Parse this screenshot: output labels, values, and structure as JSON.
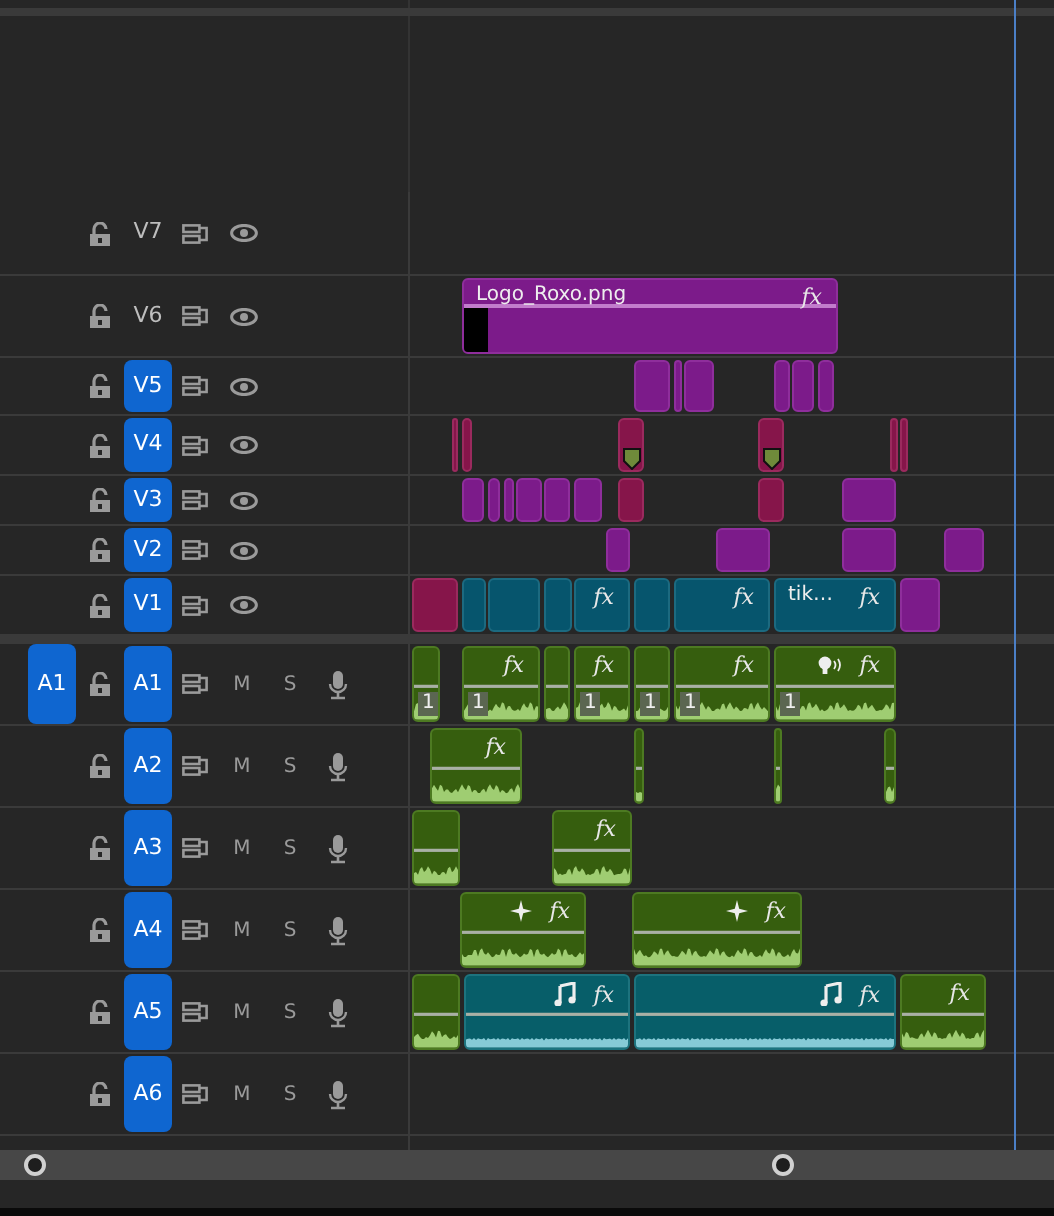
{
  "source_patch": {
    "label": "A1",
    "selected": true
  },
  "video_tracks": [
    {
      "name": "V7",
      "targeted": false
    },
    {
      "name": "V6",
      "targeted": false,
      "clips": [
        {
          "kind": "graphic",
          "label": "Logo_Roxo.png",
          "fx": "fx",
          "thumbnail": true
        }
      ]
    },
    {
      "name": "V5",
      "targeted": true,
      "clips": [
        {
          "kind": "graphic"
        },
        {
          "kind": "graphic"
        },
        {
          "kind": "graphic"
        },
        {
          "kind": "graphic"
        },
        {
          "kind": "graphic"
        },
        {
          "kind": "graphic"
        }
      ]
    },
    {
      "name": "V4",
      "targeted": true,
      "clips": [
        {
          "kind": "nested",
          "marker": false
        },
        {
          "kind": "nested",
          "marker": false
        },
        {
          "kind": "nested",
          "marker": true
        },
        {
          "kind": "nested",
          "marker": true
        },
        {
          "kind": "nested",
          "marker": false
        },
        {
          "kind": "nested",
          "marker": false
        }
      ]
    },
    {
      "name": "V3",
      "targeted": true,
      "clips": [
        {
          "kind": "graphic"
        },
        {
          "kind": "graphic"
        },
        {
          "kind": "graphic"
        },
        {
          "kind": "graphic"
        },
        {
          "kind": "graphic"
        },
        {
          "kind": "graphic"
        },
        {
          "kind": "nested"
        },
        {
          "kind": "nested"
        },
        {
          "kind": "graphic"
        }
      ]
    },
    {
      "name": "V2",
      "targeted": true,
      "clips": [
        {
          "kind": "graphic"
        },
        {
          "kind": "graphic"
        },
        {
          "kind": "graphic"
        },
        {
          "kind": "graphic"
        }
      ]
    },
    {
      "name": "V1",
      "targeted": true,
      "clips": [
        {
          "kind": "nested"
        },
        {
          "kind": "video"
        },
        {
          "kind": "video"
        },
        {
          "kind": "video"
        },
        {
          "kind": "video",
          "fx": "fx"
        },
        {
          "kind": "video"
        },
        {
          "kind": "video",
          "fx": "fx"
        },
        {
          "kind": "video",
          "label": "tik…",
          "fx": "fx"
        },
        {
          "kind": "graphic"
        }
      ]
    }
  ],
  "audio_tracks": [
    {
      "name": "A1",
      "targeted": true,
      "mute": "M",
      "solo": "S",
      "clips": [
        {
          "kind": "audio",
          "channel": "1"
        },
        {
          "kind": "audio",
          "channel": "1",
          "fx": "fx"
        },
        {
          "kind": "audio"
        },
        {
          "kind": "audio",
          "channel": "1",
          "fx": "fx"
        },
        {
          "kind": "audio",
          "channel": "1"
        },
        {
          "kind": "audio",
          "channel": "1",
          "fx": "fx"
        },
        {
          "kind": "speech",
          "channel": "1",
          "fx": "fx"
        }
      ]
    },
    {
      "name": "A2",
      "targeted": true,
      "mute": "M",
      "solo": "S",
      "clips": [
        {
          "kind": "audio",
          "fx": "fx"
        },
        {
          "kind": "audio"
        },
        {
          "kind": "audio"
        },
        {
          "kind": "audio"
        }
      ]
    },
    {
      "name": "A3",
      "targeted": true,
      "mute": "M",
      "solo": "S",
      "clips": [
        {
          "kind": "audio"
        },
        {
          "kind": "audio",
          "fx": "fx"
        }
      ]
    },
    {
      "name": "A4",
      "targeted": true,
      "mute": "M",
      "solo": "S",
      "clips": [
        {
          "kind": "enhanced",
          "fx": "fx"
        },
        {
          "kind": "enhanced",
          "fx": "fx"
        }
      ]
    },
    {
      "name": "A5",
      "targeted": true,
      "mute": "M",
      "solo": "S",
      "clips": [
        {
          "kind": "audio"
        },
        {
          "kind": "music",
          "fx": "fx"
        },
        {
          "kind": "music",
          "fx": "fx"
        },
        {
          "kind": "audio",
          "fx": "fx"
        }
      ]
    },
    {
      "name": "A6",
      "targeted": true,
      "mute": "M",
      "solo": "S"
    }
  ]
}
